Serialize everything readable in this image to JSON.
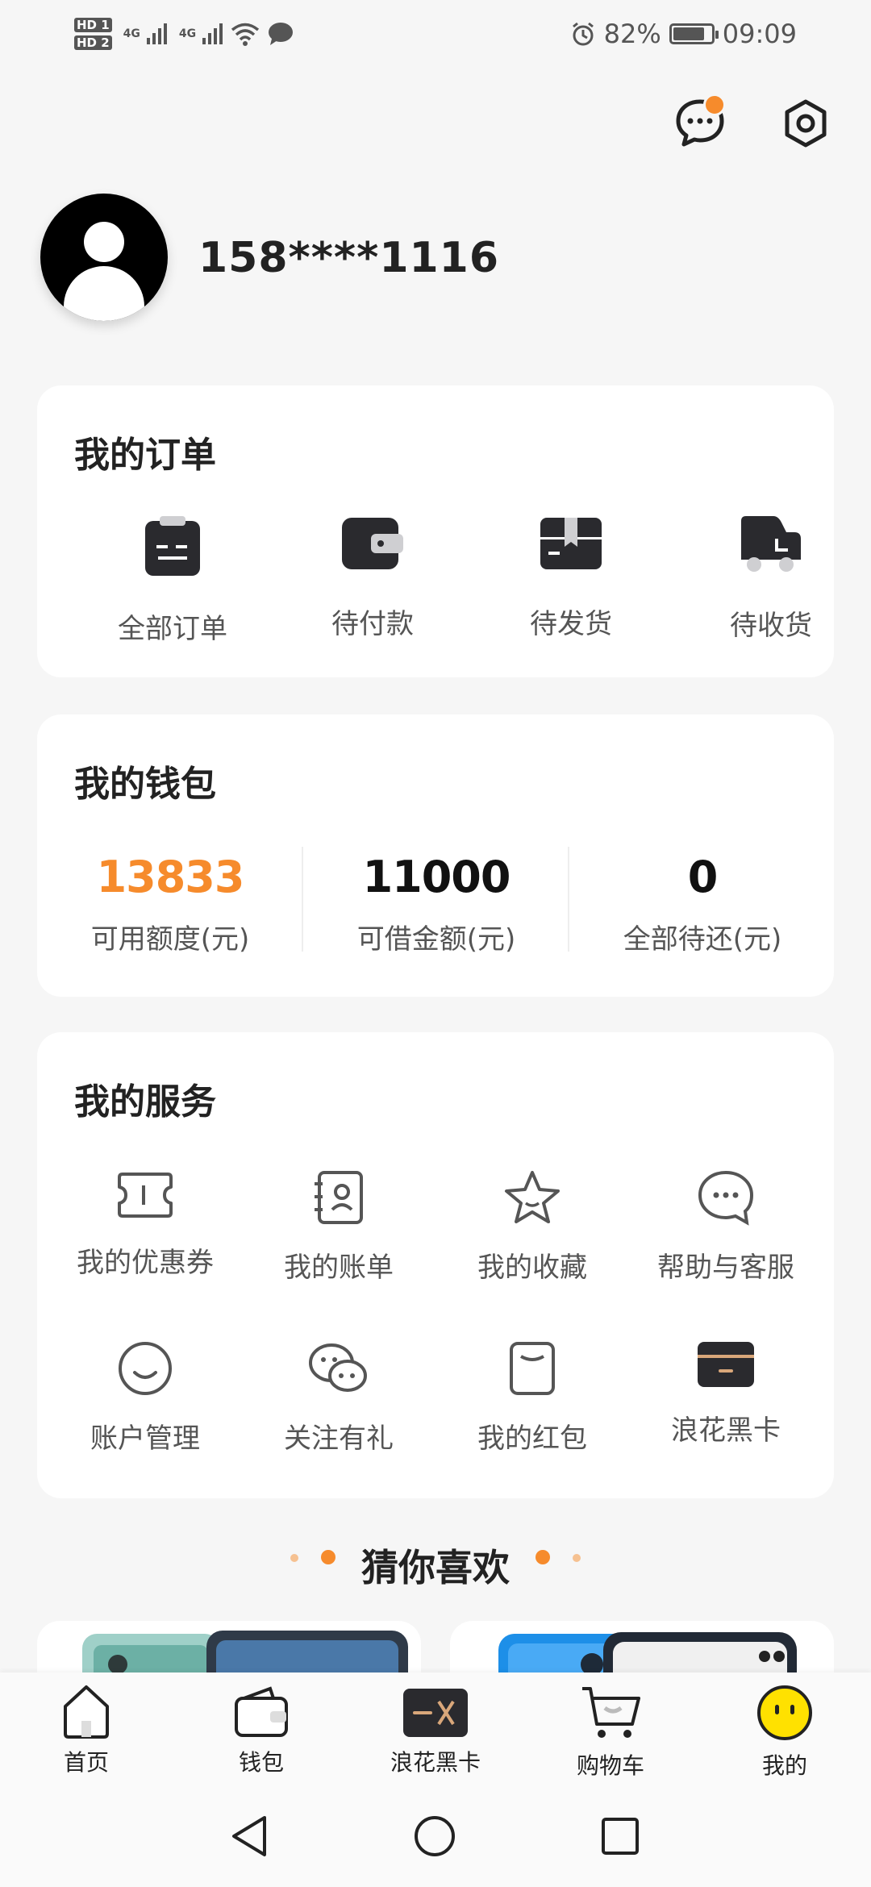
{
  "status_bar": {
    "hd1": "HD 1",
    "hd2": "HD 2",
    "net1": "4G",
    "net2": "4G",
    "battery_percent": "82%",
    "battery_level": 0.82,
    "time": "09:09"
  },
  "header": {
    "message_icon": "chat-bubble-icon",
    "settings_icon": "hexagon-gear-icon"
  },
  "profile": {
    "phone": "158****1116"
  },
  "orders": {
    "title": "我的订单",
    "items": [
      {
        "label": "全部订单",
        "icon": "clipboard-icon"
      },
      {
        "label": "待付款",
        "icon": "wallet-icon"
      },
      {
        "label": "待发货",
        "icon": "package-icon"
      },
      {
        "label": "待收货",
        "icon": "truck-icon"
      }
    ]
  },
  "wallet": {
    "title": "我的钱包",
    "items": [
      {
        "value": "13833",
        "label": "可用额度(元)"
      },
      {
        "value": "11000",
        "label": "可借金额(元)"
      },
      {
        "value": "0",
        "label": "全部待还(元)"
      }
    ]
  },
  "services": {
    "title": "我的服务",
    "items": [
      {
        "label": "我的优惠券",
        "icon": "coupon-icon"
      },
      {
        "label": "我的账单",
        "icon": "bill-icon"
      },
      {
        "label": "我的收藏",
        "icon": "star-icon"
      },
      {
        "label": "帮助与客服",
        "icon": "chat-icon"
      },
      {
        "label": "账户管理",
        "icon": "smile-icon"
      },
      {
        "label": "关注有礼",
        "icon": "wechat-icon"
      },
      {
        "label": "我的红包",
        "icon": "red-envelope-icon"
      },
      {
        "label": "浪花黑卡",
        "icon": "black-card-icon"
      }
    ]
  },
  "recommend": {
    "title": "猜你喜欢"
  },
  "tabbar": {
    "items": [
      {
        "label": "首页",
        "icon": "home-icon"
      },
      {
        "label": "钱包",
        "icon": "wallet-icon"
      },
      {
        "label": "浪花黑卡",
        "icon": "black-card-icon"
      },
      {
        "label": "购物车",
        "icon": "cart-icon"
      },
      {
        "label": "我的",
        "icon": "face-icon"
      }
    ]
  },
  "colors": {
    "accent": "#f68b2c",
    "background": "#f6f6f6",
    "card": "#ffffff",
    "text": "#222222",
    "muted": "#555555"
  }
}
